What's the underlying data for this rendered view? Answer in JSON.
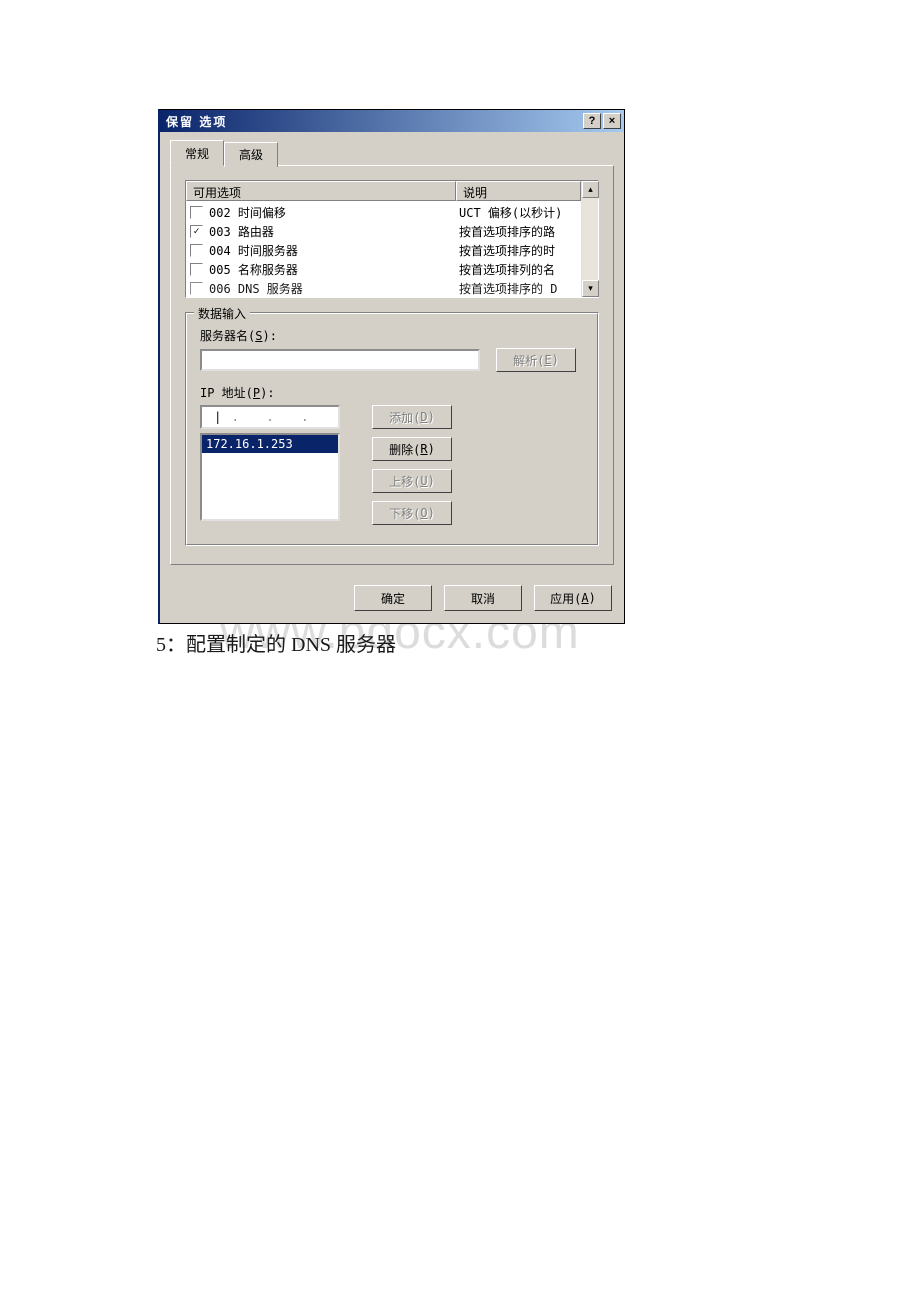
{
  "dialog": {
    "title": "保留 选项",
    "help_icon": "?",
    "close_icon": "×"
  },
  "tabs": {
    "general": "常规",
    "advanced": "高级"
  },
  "options_list": {
    "col_available": "可用选项",
    "col_description": "说明",
    "rows": [
      {
        "checked": false,
        "name": "002 时间偏移",
        "desc": "UCT 偏移(以秒计)"
      },
      {
        "checked": true,
        "name": "003 路由器",
        "desc": "按首选项排序的路"
      },
      {
        "checked": false,
        "name": "004 时间服务器",
        "desc": "按首选项排序的时"
      },
      {
        "checked": false,
        "name": "005 名称服务器",
        "desc": "按首选项排列的名"
      },
      {
        "checked": false,
        "name": "006 DNS 服务器",
        "desc": "按首选项排序的 D"
      }
    ]
  },
  "data_entry": {
    "legend": "数据输入",
    "server_name_label": "服务器名(S):",
    "resolve_btn": "解析(E)",
    "ip_label": "IP 地址(P):",
    "add_btn": "添加(D)",
    "remove_btn": "删除(R)",
    "up_btn": "上移(U)",
    "down_btn": "下移(O)",
    "ip_list": [
      "172.16.1.253"
    ]
  },
  "buttons": {
    "ok": "确定",
    "cancel": "取消",
    "apply": "应用(A)"
  },
  "caption": "5：配置制定的 DNS 服务器",
  "watermark": "www.bdocx.com"
}
